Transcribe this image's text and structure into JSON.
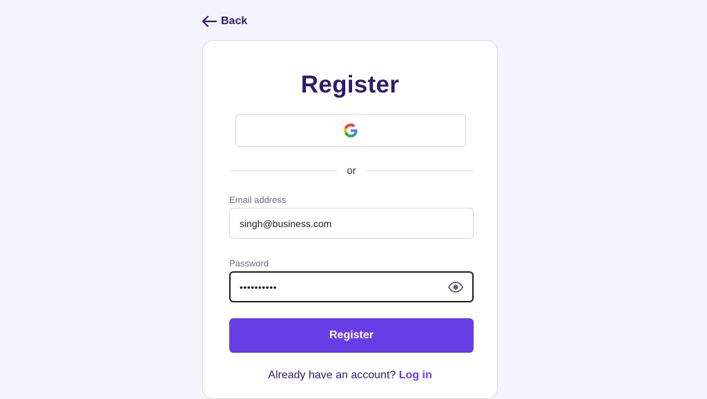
{
  "nav": {
    "back_label": "Back"
  },
  "form": {
    "title": "Register",
    "divider_text": "or",
    "email": {
      "label": "Email address",
      "value": "singh@business.com"
    },
    "password": {
      "label": "Password",
      "value_masked": "••••••••••"
    },
    "submit_label": "Register",
    "footer": {
      "prompt": "Already have an account?",
      "login_label": "Log in"
    }
  },
  "icons": {
    "back": "arrow-left-icon",
    "google": "google-logo-icon",
    "toggle_password": "eye-icon"
  },
  "colors": {
    "primary": "#673de6",
    "heading": "#2f1c6a",
    "background": "#f4f4fc"
  }
}
